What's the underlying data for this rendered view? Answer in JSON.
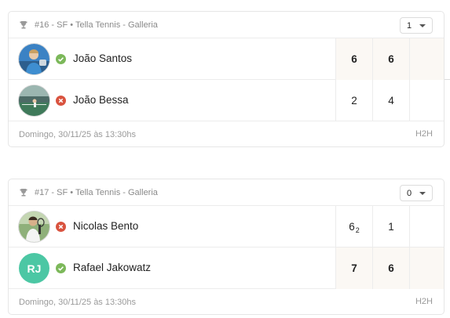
{
  "matches": [
    {
      "header": "#16 - SF • Tella Tennis - Galleria",
      "selector_value": "1",
      "players": [
        {
          "name": "João Santos",
          "status": "won",
          "scores": [
            "6",
            "6",
            ""
          ],
          "tiebreak": [
            "",
            "",
            ""
          ]
        },
        {
          "name": "João Bessa",
          "status": "lost",
          "scores": [
            "2",
            "4",
            ""
          ],
          "tiebreak": [
            "",
            "",
            ""
          ]
        }
      ],
      "date": "Domingo, 30/11/25 às 13:30hs",
      "h2h_label": "H2H"
    },
    {
      "header": "#17 - SF • Tella Tennis - Galleria",
      "selector_value": "0",
      "players": [
        {
          "name": "Nicolas Bento",
          "status": "lost",
          "scores": [
            "6",
            "1",
            ""
          ],
          "tiebreak": [
            "2",
            "",
            ""
          ]
        },
        {
          "name": "Rafael Jakowatz",
          "initials": "RJ",
          "status": "won",
          "scores": [
            "7",
            "6",
            ""
          ],
          "tiebreak": [
            "",
            "",
            ""
          ]
        }
      ],
      "date": "Domingo, 30/11/25 às 13:30hs",
      "h2h_label": "H2H"
    }
  ],
  "colors": {
    "won_icon": "#7cb85a",
    "lost_icon": "#d9533f",
    "initials_avatar": "#4cc7a4",
    "winner_cell_bg": "#fbf8f4"
  },
  "icons": {
    "header": "trophy-icon",
    "won": "check-circle-icon",
    "lost": "x-circle-icon",
    "selector": "chevron-down-icon"
  }
}
